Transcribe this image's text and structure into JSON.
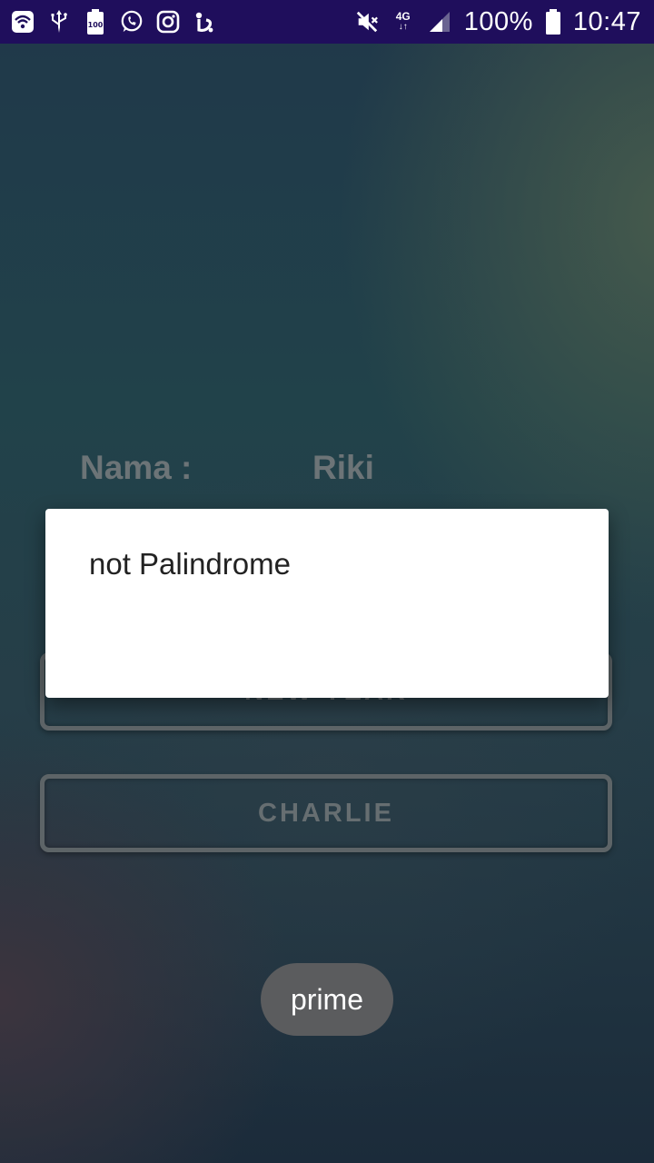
{
  "status_bar": {
    "left_icons": [
      "wifi-icon",
      "usb-icon",
      "battery-100-icon",
      "whatsapp-icon",
      "instagram-icon",
      "app-notification-icon"
    ],
    "battery_small_label": "100",
    "network_label": "4G",
    "battery_percent": "100%",
    "time": "10:47"
  },
  "form": {
    "name_label": "Nama :",
    "name_value": "Riki"
  },
  "buttons": {
    "new_year_label": "NEW YEAR",
    "charlie_label": "CHARLIE"
  },
  "dialog": {
    "message": "not Palindrome"
  },
  "toast": {
    "text": "prime"
  },
  "colors": {
    "status_bar_bg": "#1f0e5c",
    "dialog_bg": "#ffffff",
    "toast_bg": "#5b5c5e",
    "muted_text": "#6c7477"
  }
}
